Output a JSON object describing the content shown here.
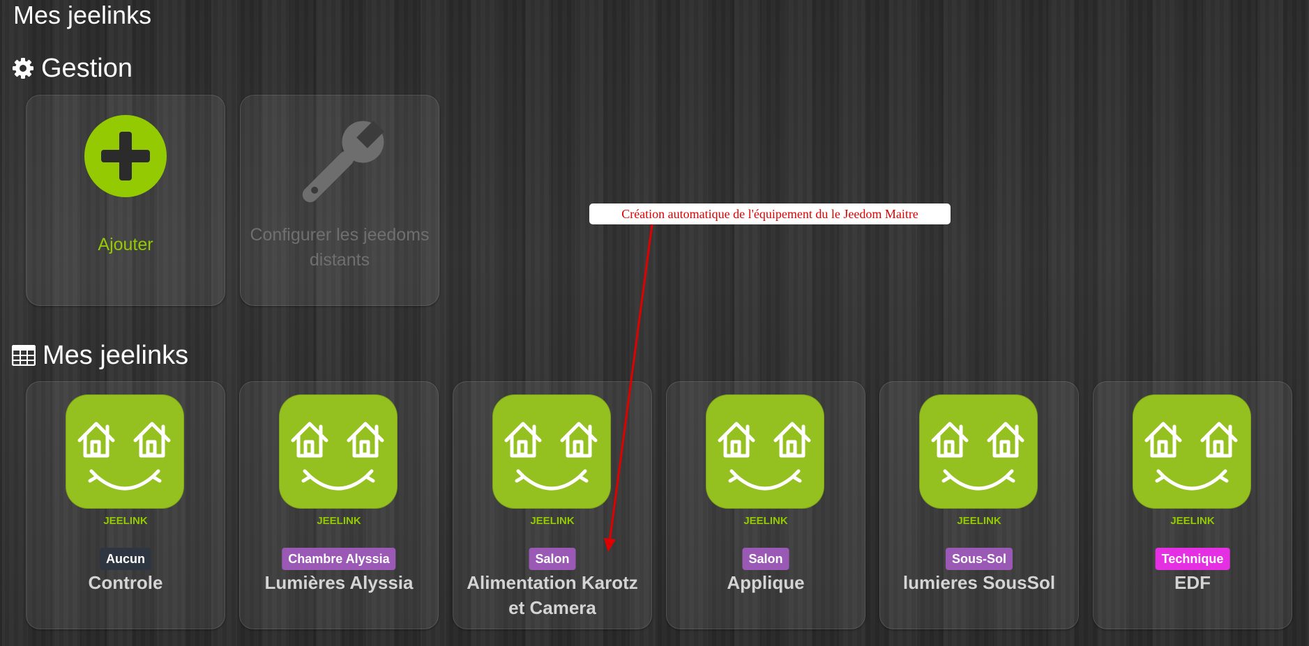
{
  "page": {
    "title": "Mes jeelinks"
  },
  "gestion": {
    "title": "Gestion",
    "icon": "cog-icon",
    "add_label": "Ajouter",
    "config_label": "Configurer les jeedoms distants"
  },
  "equipments": {
    "title": "Mes jeelinks",
    "icon": "table-icon",
    "plugin_label": "JEELINK",
    "items": [
      {
        "object": "Aucun",
        "name": "Controle",
        "badge_color": "#2e3641"
      },
      {
        "object": "Chambre Alyssia",
        "name": "Lumières Alyssia",
        "badge_color": "#9b59b6"
      },
      {
        "object": "Salon",
        "name": "Alimentation Karotz et Camera",
        "badge_color": "#9b59b6"
      },
      {
        "object": "Salon",
        "name": "Applique",
        "badge_color": "#9b59b6"
      },
      {
        "object": "Sous-Sol",
        "name": "lumieres SousSol",
        "badge_color": "#9b59b6"
      },
      {
        "object": "Technique",
        "name": "EDF",
        "badge_color": "#e52fe3"
      }
    ]
  },
  "annotation": {
    "text": "Création automatique de l'équipement du le Jeedom Maitre",
    "color": "#e00000"
  },
  "colors": {
    "accent": "#94ca02",
    "icon_bg": "#94c11f"
  }
}
